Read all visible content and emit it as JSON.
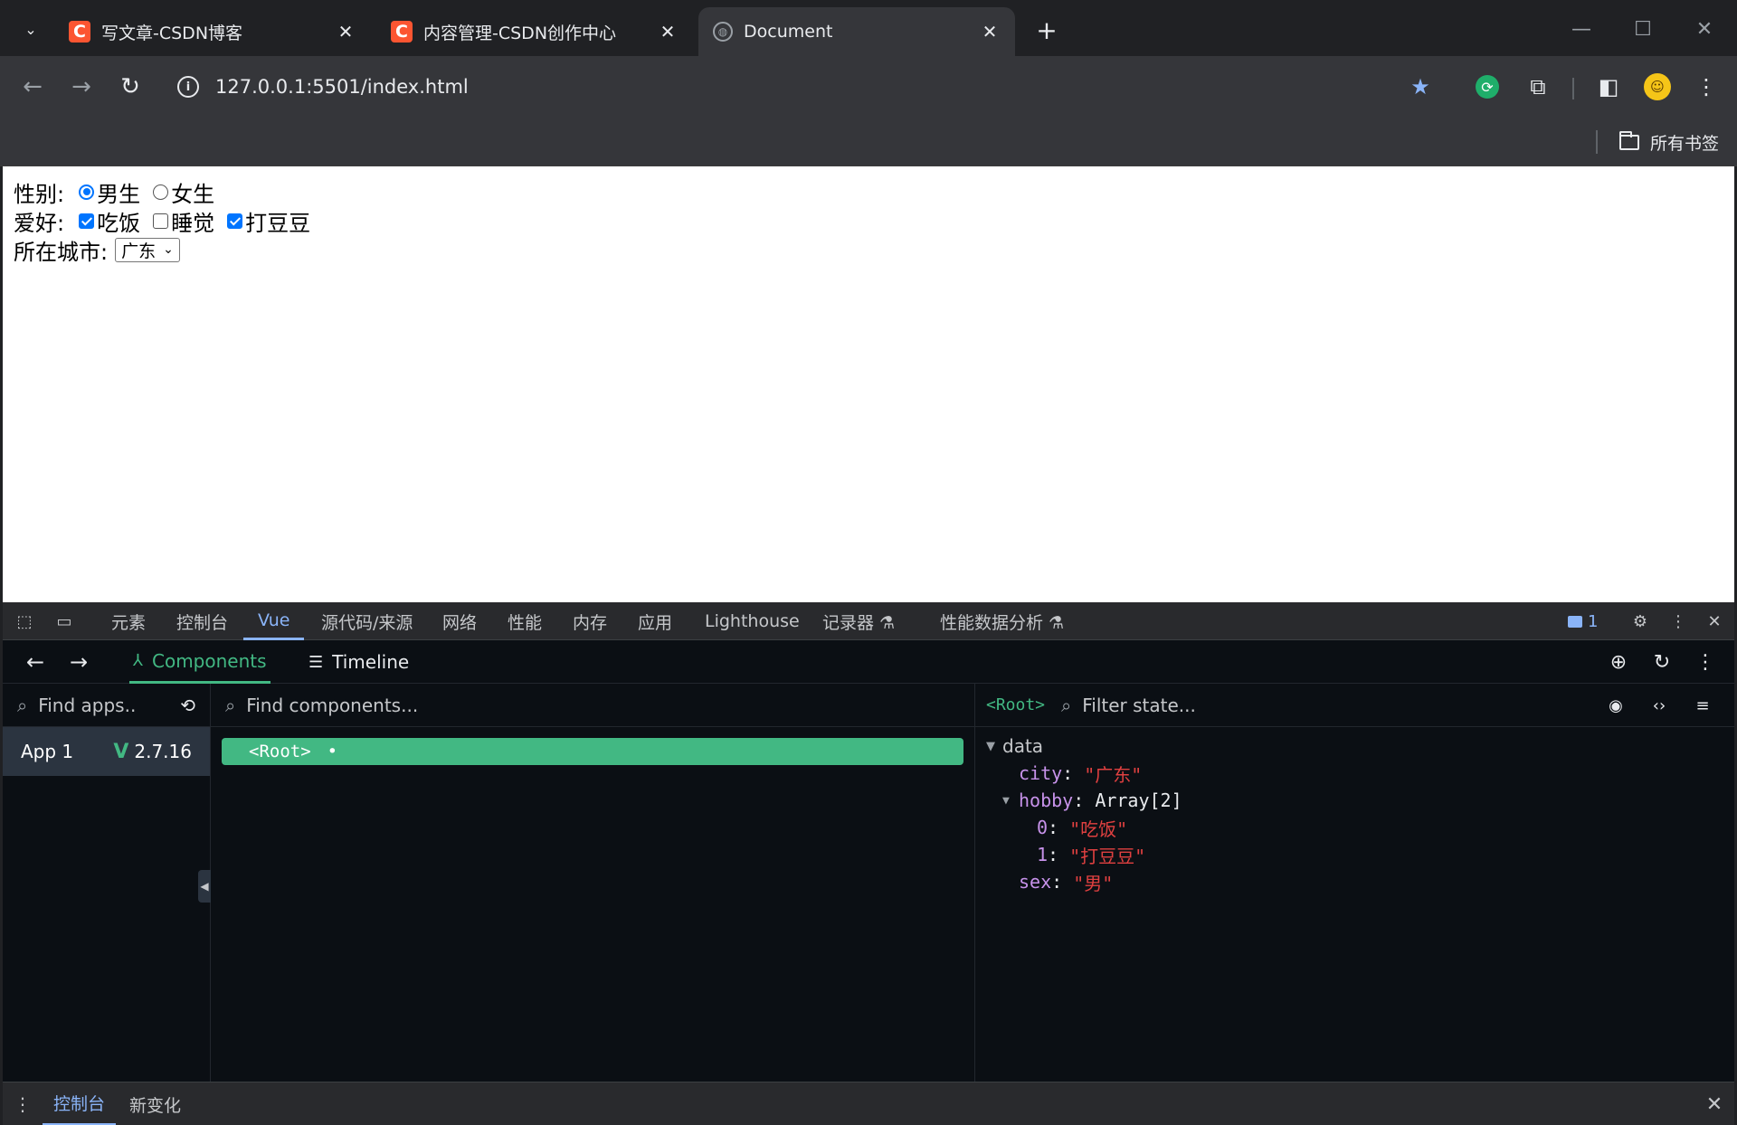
{
  "browser": {
    "tabs": [
      {
        "title": "写文章-CSDN博客",
        "favicon": "C"
      },
      {
        "title": "内容管理-CSDN创作中心",
        "favicon": "C"
      },
      {
        "title": "Document",
        "favicon": "globe"
      }
    ],
    "url": "127.0.0.1:5501/index.html",
    "bookmarks_all": "所有书签",
    "avatar_glyph": "☺"
  },
  "page": {
    "sex_label": "性别:",
    "sex_options": [
      "男生",
      "女生"
    ],
    "hobby_label": "爱好:",
    "hobby_options": [
      "吃饭",
      "睡觉",
      "打豆豆"
    ],
    "city_label": "所在城市:",
    "city_selected": "广东"
  },
  "devtools": {
    "tabs": [
      "元素",
      "控制台",
      "Vue",
      "源代码/来源",
      "网络",
      "性能",
      "内存",
      "应用",
      "Lighthouse",
      "记录器 ⚗",
      "性能数据分析 ⚗"
    ],
    "active_tab": "Vue",
    "message_count": "1",
    "vue": {
      "tabs": [
        "Components",
        "Timeline"
      ],
      "find_apps_placeholder": "Find apps..",
      "find_components_placeholder": "Find components...",
      "app_name": "App 1",
      "vue_version": "2.7.16",
      "root_component": "<Root>",
      "root_dot": "•",
      "state_root_tag": "<Root>",
      "filter_state_placeholder": "Filter state...",
      "state_section": "data",
      "state": {
        "city_key": "city",
        "city_value": "\"广东\"",
        "hobby_key": "hobby",
        "hobby_type": "Array[2]",
        "hobby_items": [
          {
            "index": "0",
            "value": "\"吃饭\""
          },
          {
            "index": "1",
            "value": "\"打豆豆\""
          }
        ],
        "sex_key": "sex",
        "sex_value": "\"男\""
      }
    },
    "drawer_tabs": [
      "控制台",
      "新变化"
    ]
  },
  "colors": {
    "vue_green": "#42b883",
    "csdn_red": "#fc5531",
    "devtools_blue": "#8ab4f8",
    "radio_blue": "#0075ff"
  }
}
